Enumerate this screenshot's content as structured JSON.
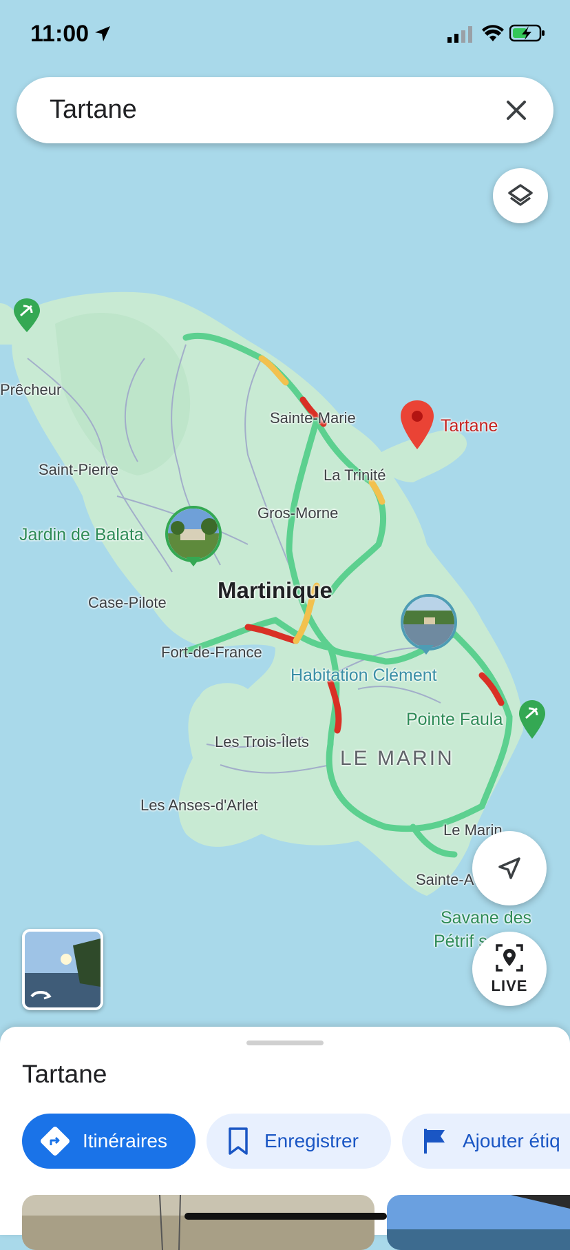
{
  "status_bar": {
    "time": "11:00"
  },
  "search": {
    "query": "Tartane"
  },
  "map": {
    "labels": {
      "precheur": "Prêcheur",
      "sainte_marie": "Sainte-Marie",
      "tartane": "Tartane",
      "saint_pierre": "Saint-Pierre",
      "la_trinite": "La Trinité",
      "gros_morne": "Gros-Morne",
      "jardin_de_balata": "Jardin de Balata",
      "martinique": "Martinique",
      "case_pilote": "Case-Pilote",
      "fort_de_france": "Fort-de-France",
      "habitation_clement": "Habitation Clément",
      "pointe_faula": "Pointe Faula",
      "les_trois_ilets": "Les Trois-Îlets",
      "le_marin_region": "LE MARIN",
      "les_anses_darlet": "Les Anses-d'Arlet",
      "le_marin": "Le Marin",
      "sainte_anne": "Sainte-A",
      "savane_line1": "Savane des",
      "savane_line2": "Pétrif     s"
    }
  },
  "live_button": {
    "label": "LIVE"
  },
  "sheet": {
    "title": "Tartane",
    "actions": {
      "directions": "Itinéraires",
      "save": "Enregistrer",
      "label": "Ajouter étiq"
    }
  },
  "colors": {
    "water": "#a9d9ea",
    "land": "#c8ead3",
    "traffic_fast": "#5cd08f",
    "traffic_medium": "#f2c14e",
    "traffic_slow": "#d93025",
    "pin": "#ea4335",
    "accent": "#1a73e8"
  },
  "icons": [
    "navigation-arrow-icon",
    "signal-icon",
    "wifi-icon",
    "battery-charging-icon",
    "close-icon",
    "layers-icon",
    "location-arrow-icon",
    "live-view-icon",
    "directions-icon",
    "bookmark-icon",
    "flag-icon",
    "place-pin-icon",
    "park-icon",
    "street-view-icon"
  ]
}
